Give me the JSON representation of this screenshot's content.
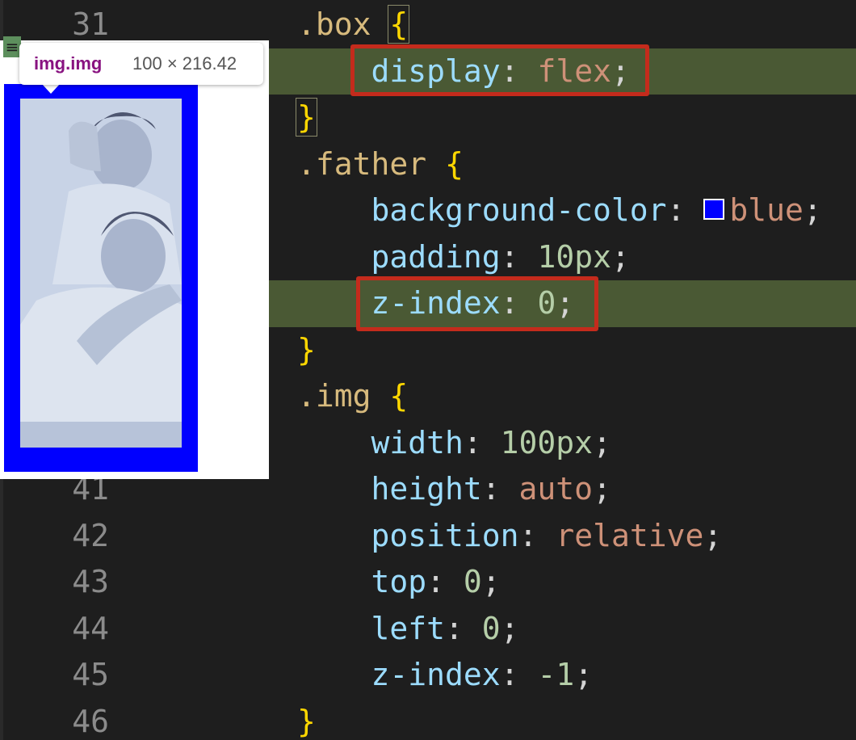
{
  "editor": {
    "lines": [
      {
        "ln": "31",
        "tokens": [
          {
            "t": ".box ",
            "c": "sel"
          },
          {
            "t": "{",
            "c": "brace"
          }
        ]
      },
      {
        "ln": "",
        "tokens": [
          {
            "t": "    display",
            "c": "prop"
          },
          {
            "t": ": ",
            "c": "punc"
          },
          {
            "t": "flex",
            "c": "val"
          },
          {
            "t": ";",
            "c": "punc"
          }
        ]
      },
      {
        "ln": "",
        "tokens": [
          {
            "t": "}",
            "c": "brace"
          }
        ]
      },
      {
        "ln": "",
        "tokens": [
          {
            "t": ".father ",
            "c": "sel"
          },
          {
            "t": "{",
            "c": "brace"
          }
        ]
      },
      {
        "ln": "",
        "tokens": [
          {
            "t": "    background-color",
            "c": "prop"
          },
          {
            "t": ": ",
            "c": "punc"
          },
          {
            "t": "blue",
            "c": "val"
          },
          {
            "t": ";",
            "c": "punc"
          }
        ]
      },
      {
        "ln": "",
        "tokens": [
          {
            "t": "    padding",
            "c": "prop"
          },
          {
            "t": ": ",
            "c": "punc"
          },
          {
            "t": "10px",
            "c": "num"
          },
          {
            "t": ";",
            "c": "punc"
          }
        ]
      },
      {
        "ln": "",
        "tokens": [
          {
            "t": "    z-index",
            "c": "prop"
          },
          {
            "t": ": ",
            "c": "punc"
          },
          {
            "t": "0",
            "c": "num"
          },
          {
            "t": ";",
            "c": "punc"
          }
        ]
      },
      {
        "ln": "",
        "tokens": [
          {
            "t": "}",
            "c": "brace"
          }
        ]
      },
      {
        "ln": "",
        "tokens": [
          {
            "t": ".img ",
            "c": "sel"
          },
          {
            "t": "{",
            "c": "brace"
          }
        ]
      },
      {
        "ln": "",
        "tokens": [
          {
            "t": "    width",
            "c": "prop"
          },
          {
            "t": ": ",
            "c": "punc"
          },
          {
            "t": "100px",
            "c": "num"
          },
          {
            "t": ";",
            "c": "punc"
          }
        ]
      },
      {
        "ln": "41",
        "tokens": [
          {
            "t": "    height",
            "c": "prop"
          },
          {
            "t": ": ",
            "c": "punc"
          },
          {
            "t": "auto",
            "c": "val"
          },
          {
            "t": ";",
            "c": "punc"
          }
        ]
      },
      {
        "ln": "42",
        "tokens": [
          {
            "t": "    position",
            "c": "prop"
          },
          {
            "t": ": ",
            "c": "punc"
          },
          {
            "t": "relative",
            "c": "val"
          },
          {
            "t": ";",
            "c": "punc"
          }
        ]
      },
      {
        "ln": "43",
        "tokens": [
          {
            "t": "    top",
            "c": "prop"
          },
          {
            "t": ": ",
            "c": "punc"
          },
          {
            "t": "0",
            "c": "num"
          },
          {
            "t": ";",
            "c": "punc"
          }
        ]
      },
      {
        "ln": "44",
        "tokens": [
          {
            "t": "    left",
            "c": "prop"
          },
          {
            "t": ": ",
            "c": "punc"
          },
          {
            "t": "0",
            "c": "num"
          },
          {
            "t": ";",
            "c": "punc"
          }
        ]
      },
      {
        "ln": "45",
        "tokens": [
          {
            "t": "    z-index",
            "c": "prop"
          },
          {
            "t": ": ",
            "c": "punc"
          },
          {
            "t": "-1",
            "c": "num"
          },
          {
            "t": ";",
            "c": "punc"
          }
        ]
      },
      {
        "ln": "46",
        "tokens": [
          {
            "t": "}",
            "c": "brace"
          }
        ]
      }
    ],
    "highlighted_lines": [
      1,
      6
    ],
    "color_swatch": "#0000ff"
  },
  "tooltip": {
    "tag": "img.img",
    "size": "100 × 216.42"
  },
  "colors": {
    "editor_bg": "#1e1e1e",
    "highlight_bg": "#4a5934",
    "annotation_red": "#c42b1c",
    "father_bg": "#0000ff"
  }
}
